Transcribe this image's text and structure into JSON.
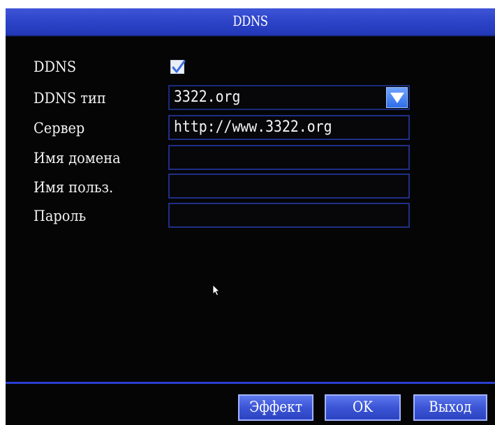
{
  "window": {
    "title": "DDNS"
  },
  "form": {
    "ddns_enable": {
      "label": "DDNS",
      "checked": true
    },
    "ddns_type": {
      "label": "DDNS тип",
      "value": "3322.org"
    },
    "server": {
      "label": "Сервер",
      "value": "http://www.3322.org"
    },
    "domain": {
      "label": "Имя домена",
      "value": ""
    },
    "username": {
      "label": "Имя польз.",
      "value": ""
    },
    "password": {
      "label": "Пароль",
      "value": ""
    }
  },
  "buttons": {
    "effect": "Эффект",
    "ok": "OK",
    "exit": "Выход"
  },
  "colors": {
    "background": "#050506",
    "titlebar": "#2e45c9",
    "field_border": "#1f2f86",
    "button": "#3b55d6",
    "dropdown_button": "#2f6ee8",
    "text": "#ffffff"
  },
  "icons": {
    "checkbox": "checkmark-icon",
    "dropdown": "triangle-down-icon",
    "cursor": "mouse-pointer-icon"
  }
}
